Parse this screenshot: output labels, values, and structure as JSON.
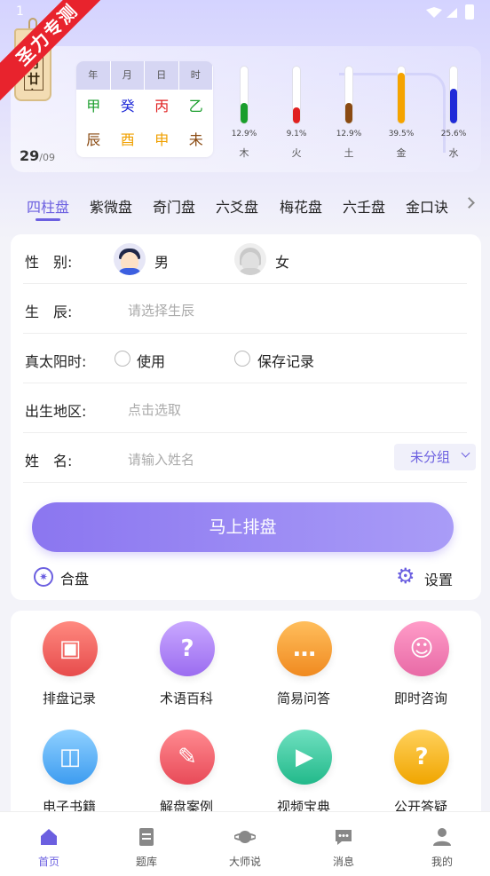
{
  "status": {
    "time": "1"
  },
  "ribbon": {
    "text": "圣力专测"
  },
  "header": {
    "lunar_date": "八月廿七",
    "day": "29",
    "month": "/09",
    "ganzhi": {
      "headers": [
        "年",
        "月",
        "日",
        "时"
      ],
      "stems": [
        {
          "t": "甲",
          "color": "#1a9e2c"
        },
        {
          "t": "癸",
          "color": "#1f2ad8"
        },
        {
          "t": "丙",
          "color": "#e02020"
        },
        {
          "t": "乙",
          "color": "#1a9e2c"
        }
      ],
      "branches": [
        {
          "t": "辰",
          "color": "#8a4a12"
        },
        {
          "t": "酉",
          "color": "#f0a000"
        },
        {
          "t": "申",
          "color": "#f0a000"
        },
        {
          "t": "未",
          "color": "#8a4a12"
        }
      ]
    },
    "elements": [
      {
        "name": "木",
        "pct": "12.9%",
        "value": 12.9,
        "color": "#1a9e2c"
      },
      {
        "name": "火",
        "pct": "9.1%",
        "value": 9.1,
        "color": "#e02020"
      },
      {
        "name": "土",
        "pct": "12.9%",
        "value": 12.9,
        "color": "#8a4a12"
      },
      {
        "name": "金",
        "pct": "39.5%",
        "value": 39.5,
        "color": "#f5a300"
      },
      {
        "name": "水",
        "pct": "25.6%",
        "value": 25.6,
        "color": "#1f2ad8"
      }
    ]
  },
  "tabs": [
    "四柱盘",
    "紫微盘",
    "奇门盘",
    "六爻盘",
    "梅花盘",
    "六壬盘",
    "金口诀"
  ],
  "form": {
    "gender_label": "性　别:",
    "male": "男",
    "female": "女",
    "birth_label": "生　辰:",
    "birth_placeholder": "请选择生辰",
    "solar_label": "真太阳时:",
    "use_label": "使用",
    "save_label": "保存记录",
    "place_label": "出生地区:",
    "place_placeholder": "点击选取",
    "name_label": "姓　名:",
    "name_placeholder": "请输入姓名",
    "group": "未分组",
    "submit": "马上排盘",
    "hepan": "合盘",
    "setting": "设置"
  },
  "features": [
    {
      "label": "排盘记录",
      "icon": "archive-card-icon",
      "glyph": "▣",
      "from": "#ff8a80",
      "to": "#e74c4c"
    },
    {
      "label": "术语百科",
      "icon": "question-clipboard-icon",
      "glyph": "?",
      "from": "#c9a8ff",
      "to": "#9b6cf0"
    },
    {
      "label": "简易问答",
      "icon": "chat-bubble-icon",
      "glyph": "…",
      "from": "#ffbe5c",
      "to": "#f08a20"
    },
    {
      "label": "即时咨询",
      "icon": "consultant-icon",
      "glyph": "☺",
      "from": "#ff9cc8",
      "to": "#e86aa6"
    },
    {
      "label": "电子书籍",
      "icon": "book-icon",
      "glyph": "◫",
      "from": "#8fd0ff",
      "to": "#3d9cf0"
    },
    {
      "label": "解盘案例",
      "icon": "note-pen-icon",
      "glyph": "✎",
      "from": "#ff8a90",
      "to": "#e84a58"
    },
    {
      "label": "视频宝典",
      "icon": "video-icon",
      "glyph": "▶",
      "from": "#6fe0c0",
      "to": "#22b98a"
    },
    {
      "label": "公开答疑",
      "icon": "question-doc-icon",
      "glyph": "?",
      "from": "#ffd15c",
      "to": "#f0a500"
    }
  ],
  "nav": [
    {
      "label": "首页",
      "icon": "home-icon",
      "active": true
    },
    {
      "label": "题库",
      "icon": "question-bank-icon",
      "active": false
    },
    {
      "label": "大师说",
      "icon": "planet-icon",
      "active": false
    },
    {
      "label": "消息",
      "icon": "message-icon",
      "active": false
    },
    {
      "label": "我的",
      "icon": "profile-icon",
      "active": false
    }
  ],
  "colors": {
    "accent": "#6b5fe0",
    "ribbon": "#e8232d"
  }
}
